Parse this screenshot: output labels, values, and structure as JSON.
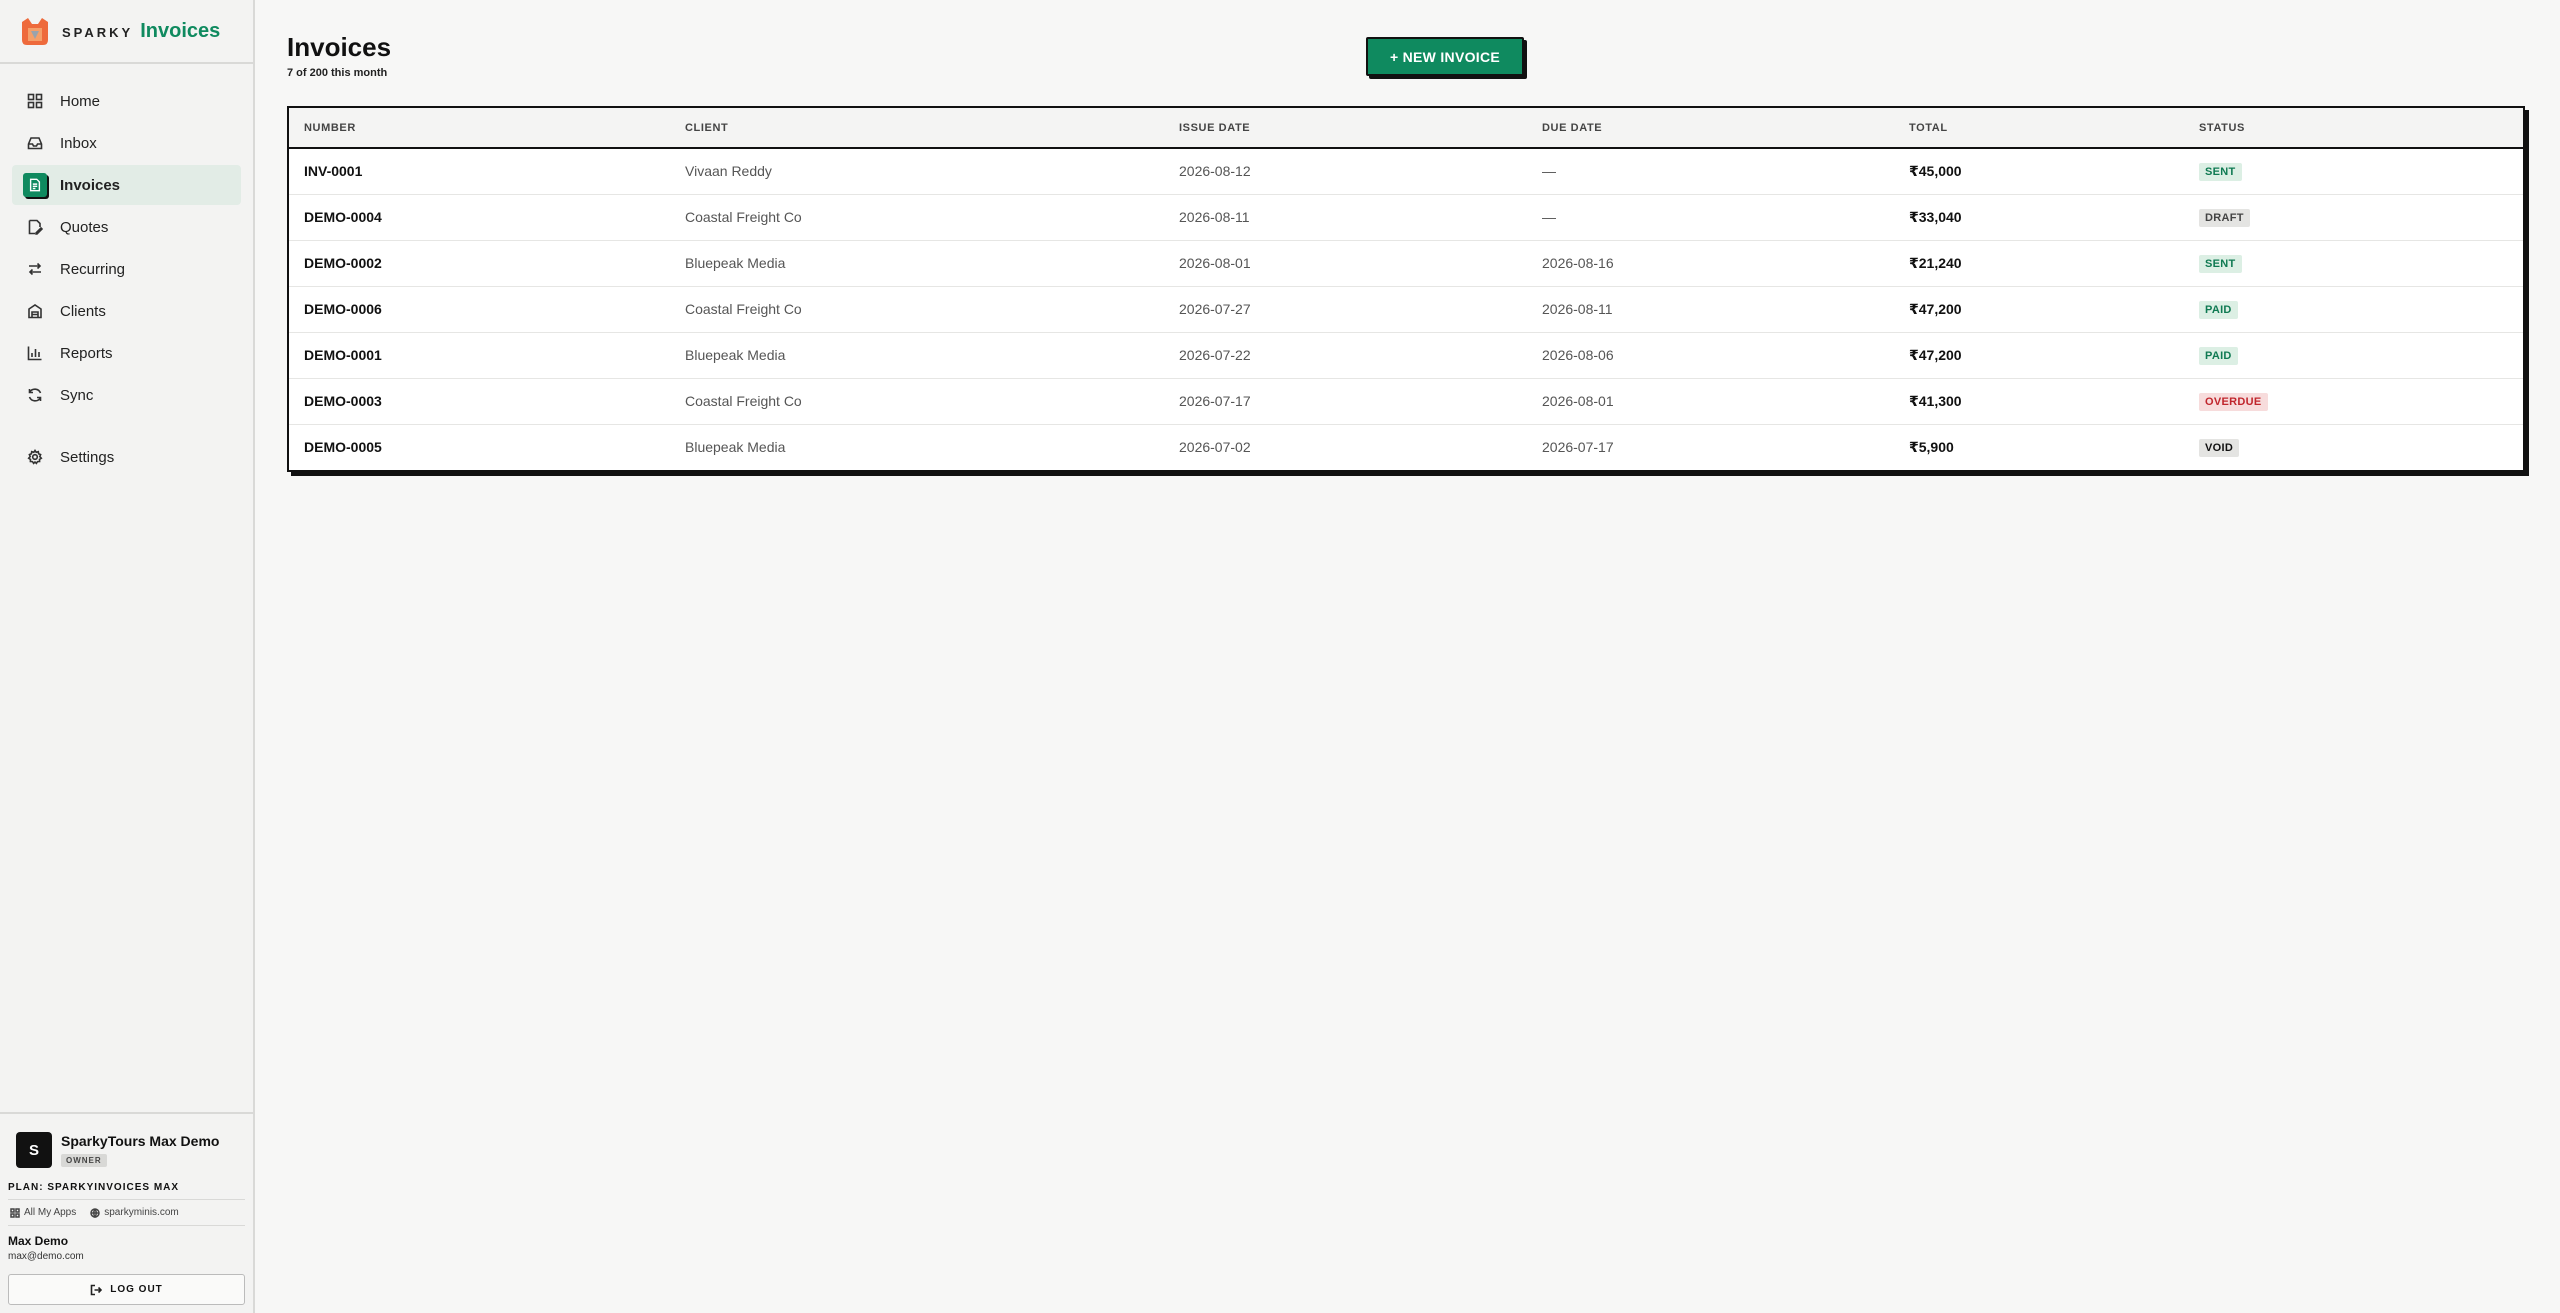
{
  "brand": {
    "sparky": "SPARKY",
    "app": "Invoices"
  },
  "nav": {
    "items": [
      {
        "label": "Home",
        "icon": "home-icon"
      },
      {
        "label": "Inbox",
        "icon": "inbox-icon"
      },
      {
        "label": "Invoices",
        "icon": "invoice-icon",
        "active": true
      },
      {
        "label": "Quotes",
        "icon": "quote-icon"
      },
      {
        "label": "Recurring",
        "icon": "recurring-icon"
      },
      {
        "label": "Clients",
        "icon": "clients-icon"
      },
      {
        "label": "Reports",
        "icon": "reports-icon"
      },
      {
        "label": "Sync",
        "icon": "sync-icon"
      }
    ],
    "settings": {
      "label": "Settings",
      "icon": "gear-icon"
    }
  },
  "org": {
    "initial": "S",
    "name": "SparkyTours Max Demo",
    "role": "OWNER"
  },
  "plan": "PLAN: SPARKYINVOICES MAX",
  "links": {
    "apps": "All My Apps",
    "site": "sparkyminis.com"
  },
  "user": {
    "name": "Max Demo",
    "email": "max@demo.com"
  },
  "logout_label": "LOG OUT",
  "page": {
    "title": "Invoices",
    "subtitle": "7 of 200 this month",
    "new_button": "+ NEW INVOICE"
  },
  "table": {
    "columns": [
      "NUMBER",
      "CLIENT",
      "ISSUE DATE",
      "DUE DATE",
      "TOTAL",
      "STATUS"
    ],
    "rows": [
      {
        "number": "INV-0001",
        "client": "Vivaan Reddy",
        "issue": "2026-08-12",
        "due": "—",
        "total": "₹45,000",
        "status": "SENT"
      },
      {
        "number": "DEMO-0004",
        "client": "Coastal Freight Co",
        "issue": "2026-08-11",
        "due": "—",
        "total": "₹33,040",
        "status": "DRAFT"
      },
      {
        "number": "DEMO-0002",
        "client": "Bluepeak Media",
        "issue": "2026-08-01",
        "due": "2026-08-16",
        "total": "₹21,240",
        "status": "SENT"
      },
      {
        "number": "DEMO-0006",
        "client": "Coastal Freight Co",
        "issue": "2026-07-27",
        "due": "2026-08-11",
        "total": "₹47,200",
        "status": "PAID"
      },
      {
        "number": "DEMO-0001",
        "client": "Bluepeak Media",
        "issue": "2026-07-22",
        "due": "2026-08-06",
        "total": "₹47,200",
        "status": "PAID"
      },
      {
        "number": "DEMO-0003",
        "client": "Coastal Freight Co",
        "issue": "2026-07-17",
        "due": "2026-08-01",
        "total": "₹41,300",
        "status": "OVERDUE"
      },
      {
        "number": "DEMO-0005",
        "client": "Bluepeak Media",
        "issue": "2026-07-02",
        "due": "2026-07-17",
        "total": "₹5,900",
        "status": "VOID"
      }
    ]
  },
  "status_colors": {
    "SENT": {
      "bg": "#dcefe4",
      "fg": "#0f7a52"
    },
    "DRAFT": {
      "bg": "#e4e4e2",
      "fg": "#444444"
    },
    "PAID": {
      "bg": "#dcefe4",
      "fg": "#0f7a52"
    },
    "OVERDUE": {
      "bg": "#f7dcdc",
      "fg": "#c0262d"
    },
    "VOID": {
      "bg": "#e4e4e2",
      "fg": "#111111"
    }
  },
  "accent": "#0f8a5f"
}
